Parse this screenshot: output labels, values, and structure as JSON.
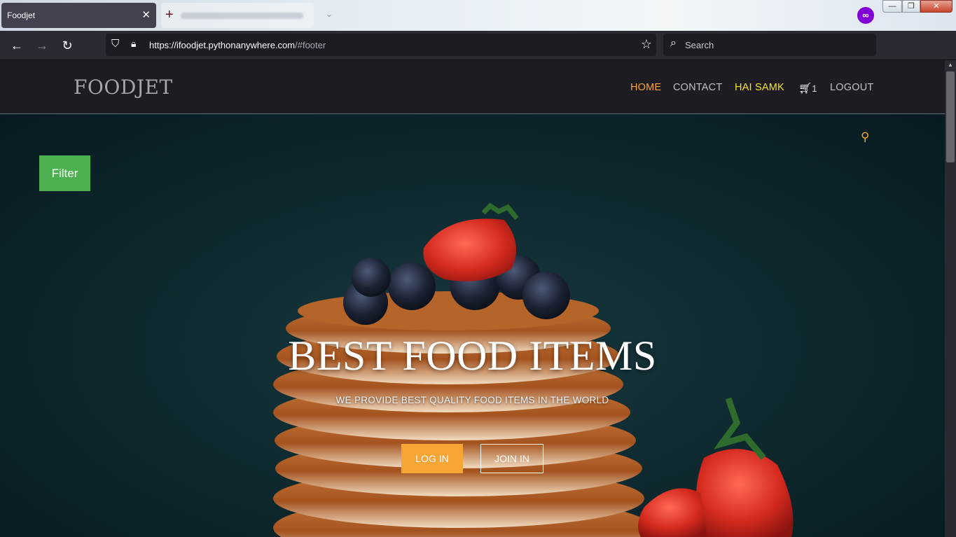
{
  "browser": {
    "tab_title": "Foodjet",
    "url_host": "https://ifoodjet.pythonanywhere.com",
    "url_path": "/#footer",
    "search_placeholder": "Search"
  },
  "site": {
    "brand": "FOODJET",
    "nav": {
      "home": "HOME",
      "contact": "CONTACT",
      "user": "HAI SAMK",
      "cart_count": "1",
      "logout": "LOGOUT"
    },
    "filter_label": "Filter",
    "hero": {
      "title": "BEST FOOD ITEMS",
      "subtitle": "WE PROVIDE BEST QUALITY FOOD ITEMS IN THE WORLD",
      "login_label": "LOG IN",
      "join_label": "JOIN IN"
    }
  },
  "icons": {
    "cart": "shopping-cart-icon",
    "search": "search-icon",
    "private": "private-browsing-icon"
  },
  "colors": {
    "accent": "#f7a534",
    "user_highlight": "#f4e41c",
    "filter_green": "#4caf50",
    "header_bg": "#1c1c22"
  }
}
